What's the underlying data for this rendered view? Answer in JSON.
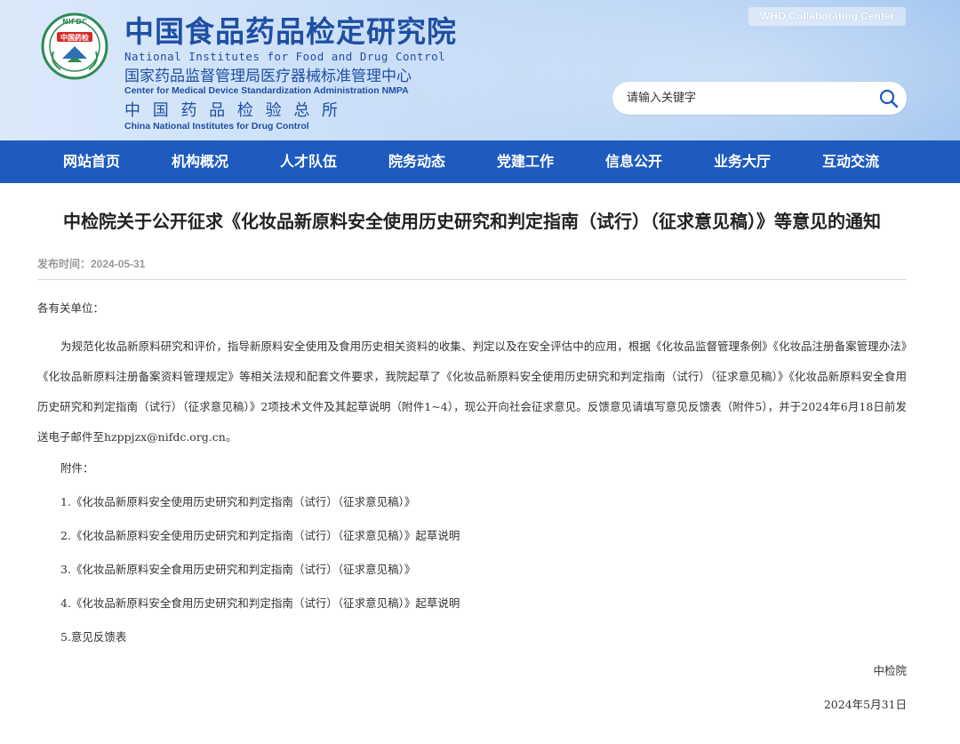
{
  "header": {
    "org_name_cn": "中国食品药品检定研究院",
    "org_name_en": "National Institutes for Food and Drug Control",
    "sub_center_cn": "国家药品监督管理局医疗器械标准管理中心",
    "sub_center_en": "Center for Medical Device Standardization Administration NMPA",
    "sub_inst_cn": "中 国 药 品 检 验 总 所",
    "sub_inst_en": "China National Institutes for Drug Control",
    "logo_ring_text": "NIFDC",
    "logo_center_text": "中国药检",
    "who_badge": "WHO Collaborating Center",
    "search_placeholder": "请输入关键字"
  },
  "nav": {
    "items": [
      "网站首页",
      "机构概况",
      "人才队伍",
      "院务动态",
      "党建工作",
      "信息公开",
      "业务大厅",
      "互动交流"
    ]
  },
  "article": {
    "title": "中检院关于公开征求《化妆品新原料安全使用历史研究和判定指南（试行）（征求意见稿）》等意见的通知",
    "publish_date": "发布时间：2024-05-31",
    "greeting": "各有关单位：",
    "paragraph": "为规范化妆品新原料研究和评价，指导新原料安全使用及食用历史相关资料的收集、判定以及在安全评估中的应用，根据《化妆品监督管理条例》《化妆品注册备案管理办法》《化妆品新原料注册备案资料管理规定》等相关法规和配套文件要求，我院起草了《化妆品新原料安全使用历史研究和判定指南（试行）（征求意见稿）》《化妆品新原料安全食用历史研究和判定指南（试行）（征求意见稿）》2项技术文件及其起草说明（附件1~4），现公开向社会征求意见。反馈意见请填写意见反馈表（附件5），并于2024年6月18日前发送电子邮件至hzppjzx@nifdc.org.cn。",
    "attachments_label": "附件：",
    "attachments": [
      "1.《化妆品新原料安全使用历史研究和判定指南（试行）（征求意见稿）》",
      "2.《化妆品新原料安全使用历史研究和判定指南（试行）（征求意见稿）》起草说明",
      "3.《化妆品新原料安全食用历史研究和判定指南（试行）（征求意见稿）》",
      "4.《化妆品新原料安全食用历史研究和判定指南（试行）（征求意见稿）》起草说明",
      "5.意见反馈表"
    ],
    "signature": "中检院",
    "date": "2024年5月31日"
  },
  "colors": {
    "brand_blue": "#1f4fa3",
    "nav_blue": "#1f5bbf"
  },
  "icons": {
    "search": "search-icon",
    "logo": "nifdc-logo-icon"
  }
}
